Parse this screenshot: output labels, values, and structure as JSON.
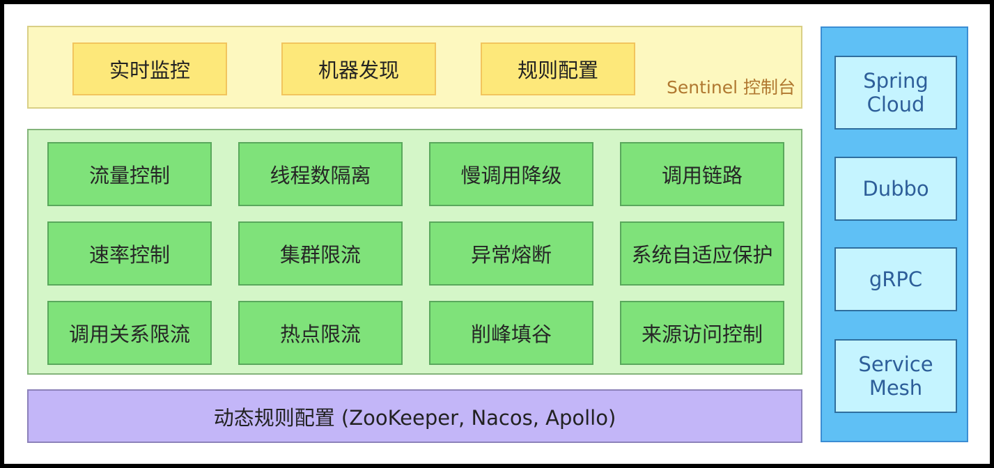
{
  "console": {
    "items": [
      "实时监控",
      "机器发现",
      "规则配置"
    ],
    "label": "Sentinel 控制台"
  },
  "features": {
    "rows": [
      [
        "流量控制",
        "线程数隔离",
        "慢调用降级",
        "调用链路"
      ],
      [
        "速率控制",
        "集群限流",
        "异常熔断",
        "系统自适应保护"
      ],
      [
        "调用关系限流",
        "热点限流",
        "削峰填谷",
        "来源访问控制"
      ]
    ]
  },
  "dynamic": {
    "label": "动态规则配置 (ZooKeeper, Nacos, Apollo)"
  },
  "frameworks": {
    "items": [
      "Spring\nCloud",
      "Dubbo",
      "gRPC",
      "Service\nMesh"
    ]
  },
  "colors": {
    "console_bg": "#fdf8bf",
    "console_box": "#fde87a",
    "feature_bg": "#d4f6c8",
    "feature_box": "#7fe27a",
    "dynamic_bg": "#c3b6f8",
    "framework_bg": "#5fc0f5",
    "framework_box": "#c5f4ff"
  }
}
